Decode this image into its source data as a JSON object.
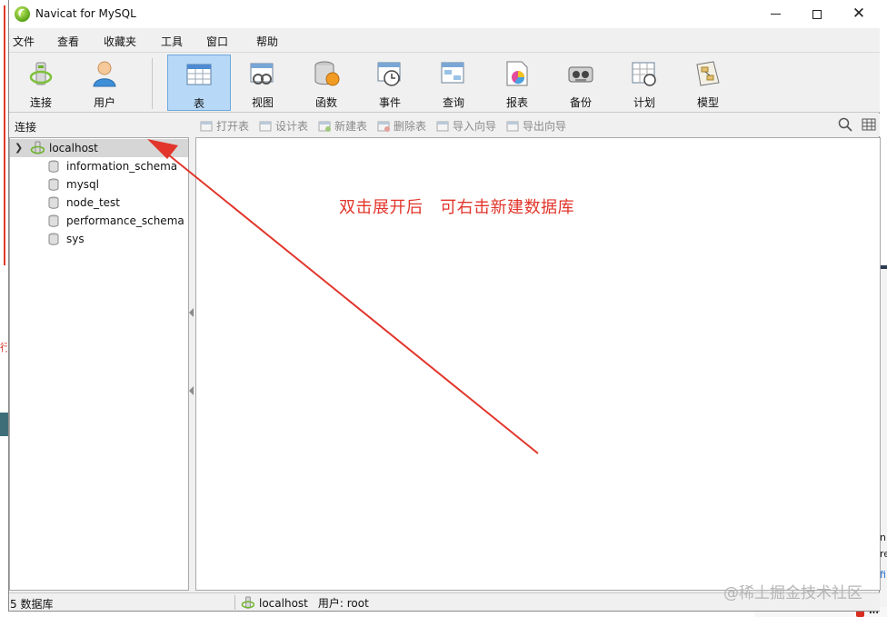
{
  "window": {
    "title": "Navicat for MySQL"
  },
  "menu": [
    "文件",
    "查看",
    "收藏夹",
    "工具",
    "窗口",
    "帮助"
  ],
  "toolbar": {
    "buttons": [
      {
        "label": "连接",
        "icon": "connection-icon"
      },
      {
        "label": "用户",
        "icon": "user-icon"
      },
      {
        "label": "表",
        "icon": "table-icon",
        "active": true
      },
      {
        "label": "视图",
        "icon": "view-icon"
      },
      {
        "label": "函数",
        "icon": "function-icon"
      },
      {
        "label": "事件",
        "icon": "event-icon"
      },
      {
        "label": "查询",
        "icon": "query-icon"
      },
      {
        "label": "报表",
        "icon": "report-icon"
      },
      {
        "label": "备份",
        "icon": "backup-icon"
      },
      {
        "label": "计划",
        "icon": "schedule-icon"
      },
      {
        "label": "模型",
        "icon": "model-icon"
      }
    ]
  },
  "subtoolbar": {
    "connection_label": "连接",
    "actions": [
      "打开表",
      "设计表",
      "新建表",
      "删除表",
      "导入向导",
      "导出向导"
    ]
  },
  "tree": {
    "connection": "localhost",
    "databases": [
      "information_schema",
      "mysql",
      "node_test",
      "performance_schema",
      "sys"
    ]
  },
  "annotation": {
    "text": "双击展开后   可右击新建数据库",
    "color": "#e2352b"
  },
  "status": {
    "db_count": "5 数据库",
    "connection": "localhost",
    "user": "用户: root"
  },
  "watermark": "@稀土掘金技术社区",
  "background": {
    "right_text_1": "n",
    "right_text_2": "re",
    "right_text_3": "fi",
    "taskbar_text": "In"
  },
  "colors": {
    "accent": "#b7d9f7",
    "selection": "#d6d6d6"
  }
}
